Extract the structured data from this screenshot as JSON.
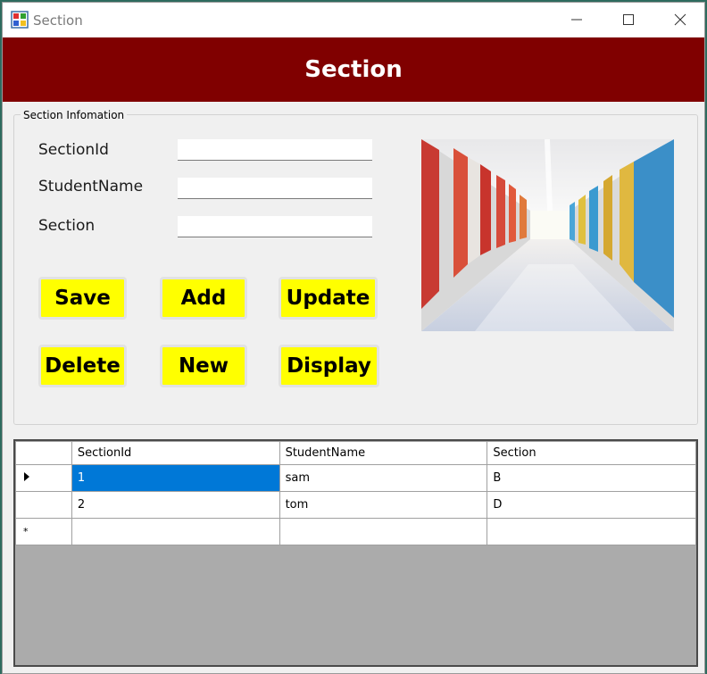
{
  "window": {
    "title": "Section",
    "header_title": "Section"
  },
  "groupbox": {
    "legend": "Section Infomation",
    "fields": [
      {
        "label": "SectionId",
        "value": ""
      },
      {
        "label": "StudentName",
        "value": ""
      },
      {
        "label": "Section",
        "value": ""
      }
    ]
  },
  "buttons": {
    "save": "Save",
    "add": "Add",
    "update": "Update",
    "delete": "Delete",
    "new": "New",
    "display": "Display"
  },
  "grid": {
    "columns": [
      "SectionId",
      "StudentName",
      "Section"
    ],
    "rows": [
      {
        "cells": [
          "1",
          "sam",
          "B"
        ],
        "selected": true
      },
      {
        "cells": [
          "2",
          "tom",
          "D"
        ],
        "selected": false
      }
    ],
    "new_row_marker": "*"
  },
  "colors": {
    "header_bg": "#800000",
    "button_bg": "#ffff00",
    "selection": "#0078d7"
  }
}
